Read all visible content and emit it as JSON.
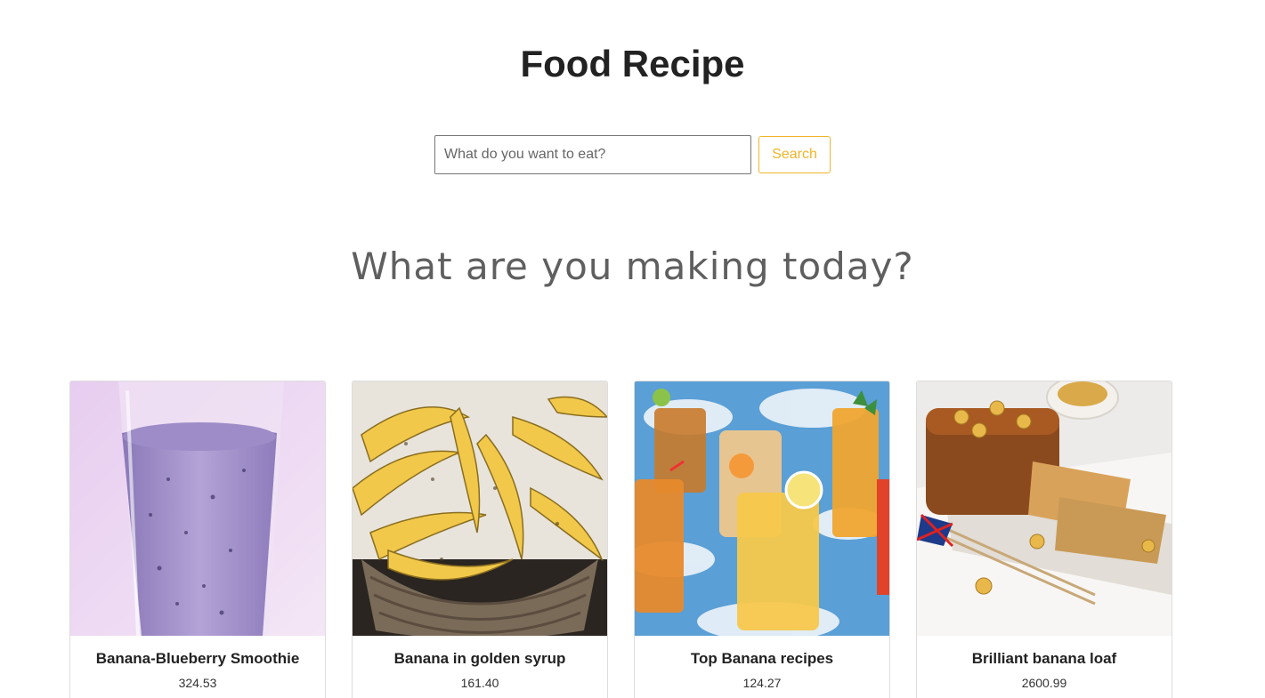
{
  "header": {
    "title": "Food Recipe"
  },
  "search": {
    "placeholder": "What do you want to eat?",
    "value": "",
    "button_label": "Search"
  },
  "main": {
    "subtitle": "What are you making today?",
    "recipes": [
      {
        "name": "Banana-Blueberry Smoothie",
        "value": "324.53",
        "image": "smoothie-photo"
      },
      {
        "name": "Banana in golden syrup",
        "value": "161.40",
        "image": "bananas-basket-photo"
      },
      {
        "name": "Top Banana recipes",
        "value": "124.27",
        "image": "drinks-photo"
      },
      {
        "name": "Brilliant banana loaf",
        "value": "2600.99",
        "image": "banana-loaf-photo"
      }
    ]
  },
  "colors": {
    "accent": "#f0b429",
    "text": "#222222"
  }
}
